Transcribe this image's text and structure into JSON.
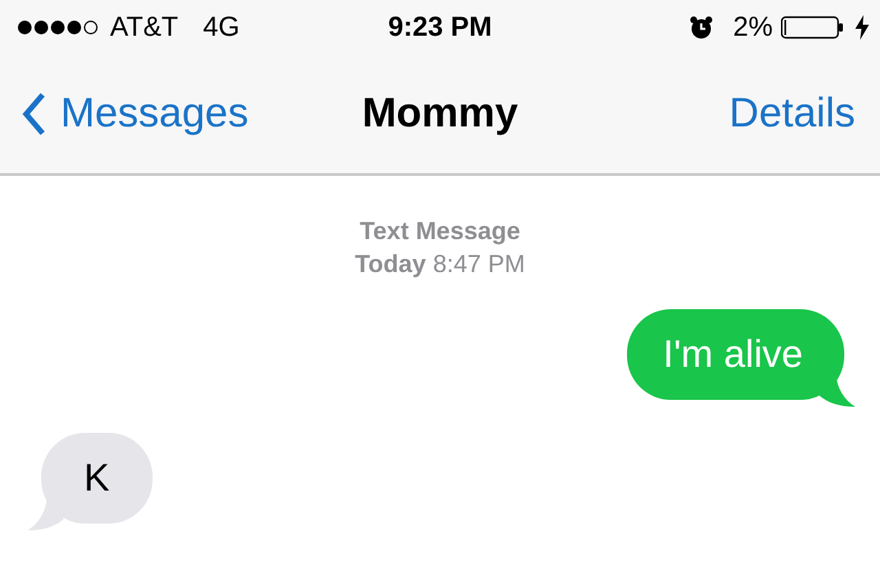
{
  "status_bar": {
    "carrier": "AT&T",
    "network": "4G",
    "time": "9:23 PM",
    "battery": "2%"
  },
  "nav_bar": {
    "back": "Messages",
    "title": "Mommy",
    "action": "Details"
  },
  "conversation": {
    "service": "Text Message",
    "timestamp": "**Today** 8:47 PM",
    "messages": [
      {
        "kind": "sent",
        "text": "I'm alive"
      },
      {
        "kind": "received",
        "text": "K"
      }
    ]
  }
}
